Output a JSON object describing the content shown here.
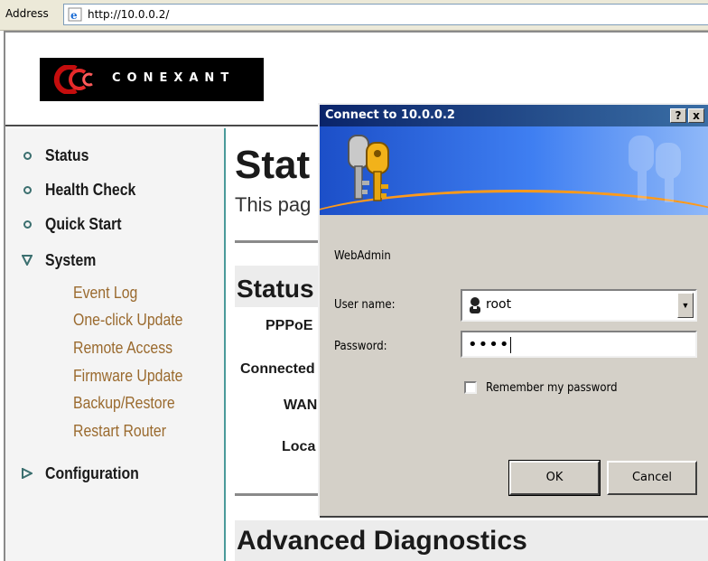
{
  "browser": {
    "address_label": "Address",
    "url": "http://10.0.0.2/",
    "ie_icon": "ie-page-icon"
  },
  "header": {
    "logo_text": "CONEXANT",
    "logo_icon": "conexant-swirl-logo"
  },
  "sidebar": {
    "items": [
      {
        "label": "Status",
        "icon": "circle-bullet-icon"
      },
      {
        "label": "Health Check",
        "icon": "circle-bullet-icon"
      },
      {
        "label": "Quick Start",
        "icon": "circle-bullet-icon"
      },
      {
        "label": "System",
        "icon": "triangle-down-icon"
      }
    ],
    "system_subitems": [
      "Event Log",
      "One-click Update",
      "Remote Access",
      "Firmware Update",
      "Backup/Restore",
      "Restart Router"
    ],
    "configuration": {
      "label": "Configuration",
      "icon": "triangle-right-icon"
    }
  },
  "main": {
    "title": "Stat",
    "description": "This pag",
    "section_title": "Status",
    "fields": [
      "PPPoE",
      "Connected",
      "WAN",
      "Loca"
    ],
    "advanced_title": "Advanced Diagnostics"
  },
  "dialog": {
    "title": "Connect to 10.0.0.2",
    "help_btn": "?",
    "close_btn": "x",
    "banner_icon": "keys-icon",
    "realm": "WebAdmin",
    "username_label": "User name:",
    "username_value": "root",
    "password_label": "Password:",
    "password_value": "••••",
    "remember_label": "Remember my password",
    "ok_label": "OK",
    "cancel_label": "Cancel"
  },
  "colors": {
    "sidebar_accent": "#3b6f6f",
    "submenu_text": "#9a6a2e",
    "titlebar_start": "#0a246a",
    "banner_blue": "#3f7ff2"
  }
}
